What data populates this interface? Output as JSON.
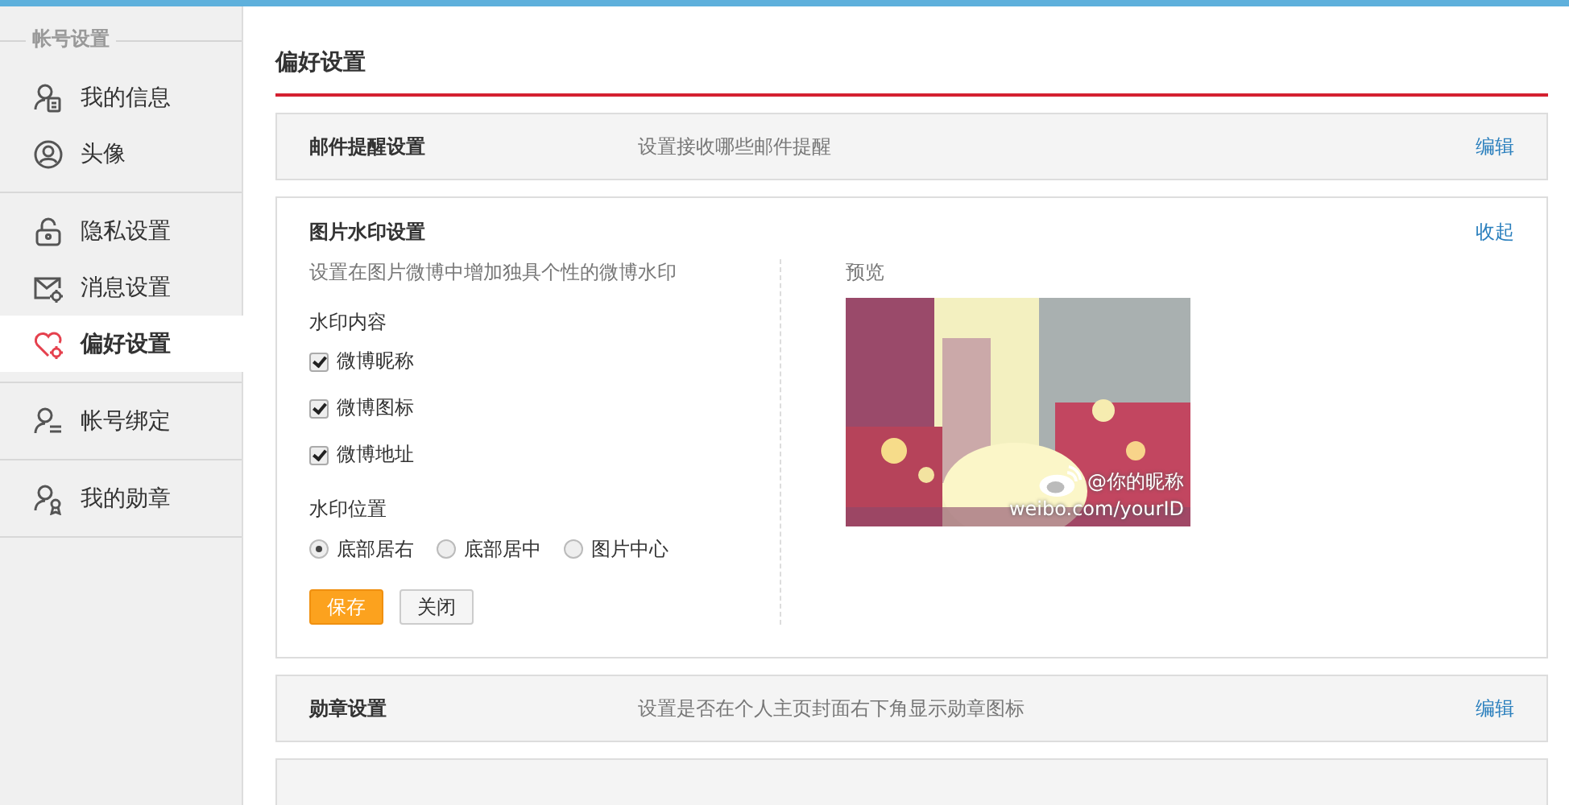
{
  "sidebar": {
    "heading": "帐号设置",
    "groups": [
      {
        "items": [
          {
            "label": "我的信息",
            "selected": false
          },
          {
            "label": "头像",
            "selected": false
          }
        ]
      },
      {
        "items": [
          {
            "label": "隐私设置",
            "selected": false
          },
          {
            "label": "消息设置",
            "selected": false
          },
          {
            "label": "偏好设置",
            "selected": true
          }
        ]
      },
      {
        "items": [
          {
            "label": "帐号绑定",
            "selected": false
          }
        ]
      },
      {
        "items": [
          {
            "label": "我的勋章",
            "selected": false
          }
        ]
      }
    ]
  },
  "page_title": "偏好设置",
  "sections": [
    {
      "kind": "collapsed",
      "title": "邮件提醒设置",
      "description": "设置接收哪些邮件提醒",
      "action": "编辑"
    },
    {
      "kind": "expanded",
      "title": "图片水印设置",
      "action": "收起",
      "description": "设置在图片微博中增加独具个性的微博水印",
      "content_label": "水印内容",
      "checkboxes": [
        {
          "label": "微博昵称",
          "checked": true
        },
        {
          "label": "微博图标",
          "checked": true
        },
        {
          "label": "微博地址",
          "checked": true
        }
      ],
      "position_label": "水印位置",
      "radios": [
        {
          "label": "底部居右",
          "selected": true
        },
        {
          "label": "底部居中",
          "selected": false
        },
        {
          "label": "图片中心",
          "selected": false
        }
      ],
      "buttons": [
        {
          "label": "保存",
          "kind": "primary"
        },
        {
          "label": "关闭",
          "kind": "secondary"
        }
      ],
      "preview_label": "预览",
      "preview": {
        "kind": "picture",
        "nickname": "@你的昵称",
        "address": "weibo.com/yourID"
      }
    },
    {
      "kind": "collapsed",
      "title": "勋章设置",
      "description": "设置是否在个人主页封面右下角显示勋章图标",
      "action": "编辑"
    },
    {
      "kind": "cut"
    }
  ]
}
